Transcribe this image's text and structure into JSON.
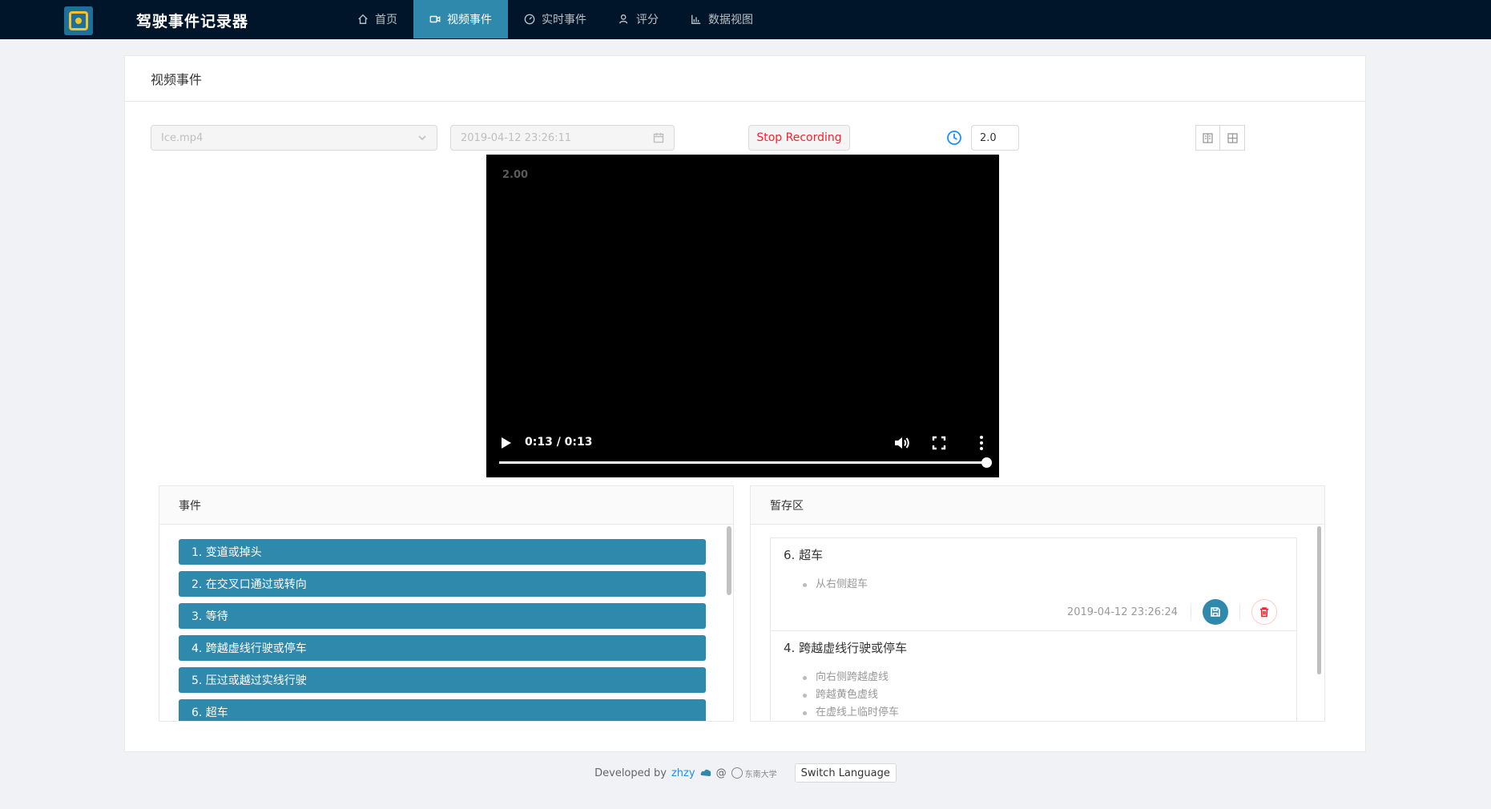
{
  "app": {
    "title": "驾驶事件记录器",
    "logo_icon": "camera-focus-icon"
  },
  "nav": [
    {
      "label": "首页",
      "icon": "home-icon",
      "active": false
    },
    {
      "label": "视频事件",
      "icon": "video-icon",
      "active": true
    },
    {
      "label": "实时事件",
      "icon": "dashboard-icon",
      "active": false
    },
    {
      "label": "评分",
      "icon": "user-icon",
      "active": false
    },
    {
      "label": "数据视图",
      "icon": "chart-icon",
      "active": false
    }
  ],
  "page": {
    "title": "视频事件"
  },
  "controls": {
    "file_select": "Ice.mp4",
    "datetime": "2019-04-12 23:26:11",
    "stop_label": "Stop Recording",
    "speed_value": "2.0"
  },
  "video": {
    "overlay_text": "2.00",
    "time": "0:13 / 0:13",
    "progress_fraction": 1.0
  },
  "events_panel": {
    "title": "事件",
    "items": [
      "1. 变道或掉头",
      "2. 在交叉口通过或转向",
      "3. 等待",
      "4. 跨越虚线行驶或停车",
      "5. 压过或越过实线行驶",
      "6. 超车"
    ]
  },
  "stash_panel": {
    "title": "暂存区",
    "items": [
      {
        "title": "6. 超车",
        "subs": [
          "从右侧超车"
        ],
        "time": "2019-04-12 23:26:24"
      },
      {
        "title": "4. 跨越虚线行驶或停车",
        "subs": [
          "向右侧跨越虚线",
          "跨越黄色虚线",
          "在虚线上临时停车"
        ]
      }
    ]
  },
  "footer": {
    "developed_by": "Developed by",
    "author": "zhzy",
    "at": "@",
    "university_logo": "东南大学",
    "switch_label": "Switch Language"
  },
  "colors": {
    "header_bg": "#001529",
    "accent": "#2f89ad",
    "danger": "#f5222d",
    "link": "#1890ff"
  }
}
